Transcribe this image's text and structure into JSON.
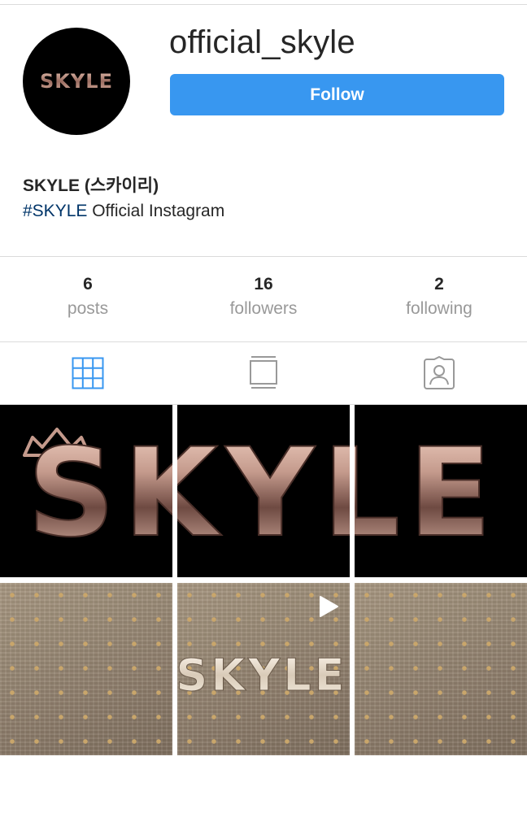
{
  "profile": {
    "username": "official_skyle",
    "follow_label": "Follow",
    "display_name": "SKYLE (스카이리)",
    "bio_hashtag": "#SKYLE",
    "bio_rest": " Official Instagram",
    "avatar_logo": "SKYLE"
  },
  "stats": [
    {
      "value": "6",
      "label": "posts"
    },
    {
      "value": "16",
      "label": "followers"
    },
    {
      "value": "2",
      "label": "following"
    }
  ],
  "tabs": [
    {
      "icon": "grid-icon",
      "active": true
    },
    {
      "icon": "feed-icon",
      "active": false
    },
    {
      "icon": "tagged-icon",
      "active": false
    }
  ],
  "posts": [
    {
      "style": "dark-logo",
      "logo_text": "SKYLE"
    },
    {
      "style": "gold-logo",
      "logo_text": "SKYLE",
      "video": true
    }
  ],
  "colors": {
    "accent": "#3897f0",
    "hashtag": "#003569",
    "muted": "#999999",
    "text": "#262626",
    "divider": "#dbdbdb",
    "logo_metal": "#c49a8c"
  }
}
